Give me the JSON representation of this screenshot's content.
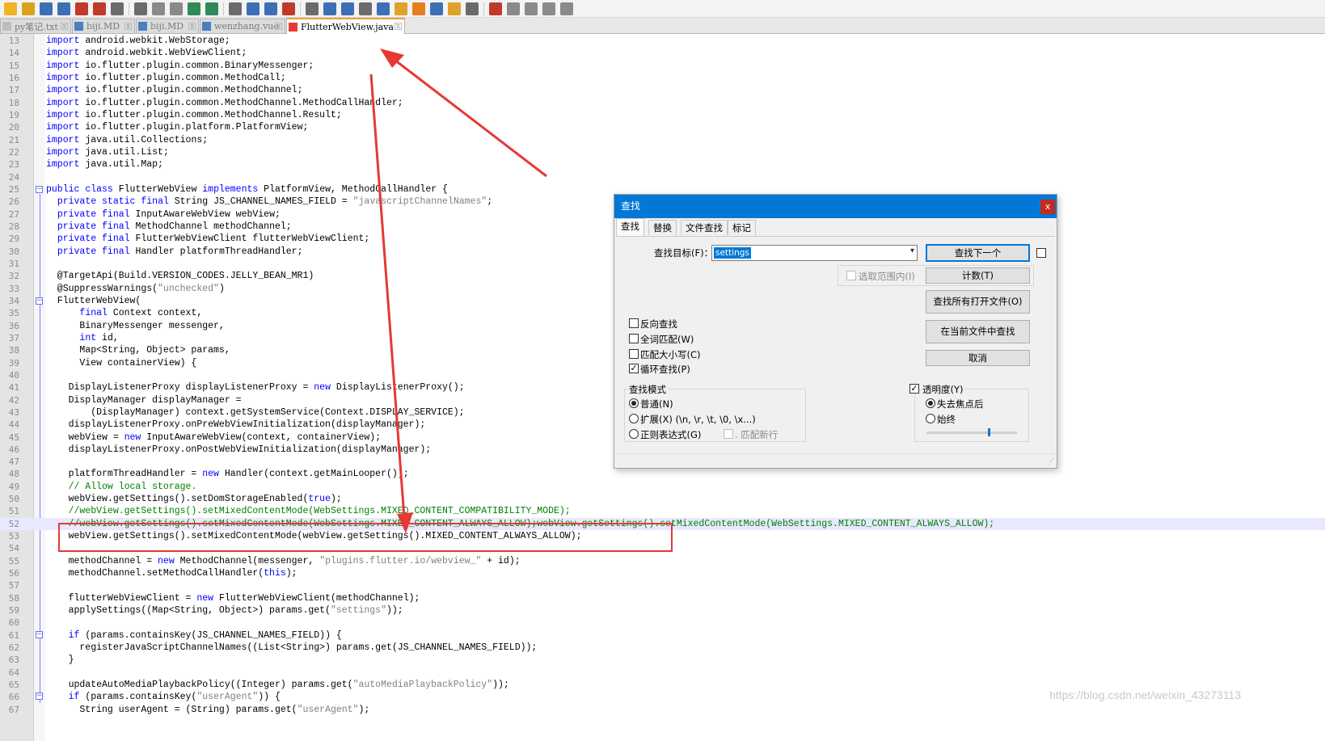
{
  "toolbar": {
    "icons": [
      "new-icon",
      "open-icon",
      "save-icon",
      "save-all-icon",
      "close-icon",
      "close-all-icon",
      "print-icon",
      "cut-icon",
      "copy-icon",
      "paste-icon",
      "undo-icon",
      "redo-icon",
      "find-icon",
      "replace-icon",
      "zoom-in-icon",
      "zoom-out-icon",
      "sync-v-icon",
      "sync-h-icon",
      "wrap-icon",
      "show-all-icon",
      "indent-guide-icon",
      "lang-icon",
      "map-icon",
      "func-list-icon",
      "folder-icon",
      "monitor-icon",
      "record-icon",
      "stop-icon",
      "play-icon",
      "play-multi-icon",
      "save-macro-icon"
    ]
  },
  "tabs": [
    {
      "label": "py笔记.txt",
      "active": false,
      "color": "#9e9e9e"
    },
    {
      "label": "biji.MD",
      "active": false,
      "color": "#4a7fc1"
    },
    {
      "label": "biji.MD",
      "active": false,
      "color": "#4a7fc1"
    },
    {
      "label": "wenzhang.vue",
      "active": false,
      "color": "#4a7fc1"
    },
    {
      "label": "FlutterWebView.java",
      "active": true,
      "color": "#e53935"
    }
  ],
  "code_lines": [
    {
      "n": "13",
      "code": "import android.webkit.WebStorage;"
    },
    {
      "n": "14",
      "code": "import android.webkit.WebViewClient;"
    },
    {
      "n": "15",
      "code": "import io.flutter.plugin.common.BinaryMessenger;"
    },
    {
      "n": "16",
      "code": "import io.flutter.plugin.common.MethodCall;"
    },
    {
      "n": "17",
      "code": "import io.flutter.plugin.common.MethodChannel;"
    },
    {
      "n": "18",
      "code": "import io.flutter.plugin.common.MethodChannel.MethodCallHandler;"
    },
    {
      "n": "19",
      "code": "import io.flutter.plugin.common.MethodChannel.Result;"
    },
    {
      "n": "20",
      "code": "import io.flutter.plugin.platform.PlatformView;"
    },
    {
      "n": "21",
      "code": "import java.util.Collections;"
    },
    {
      "n": "22",
      "code": "import java.util.List;"
    },
    {
      "n": "23",
      "code": "import java.util.Map;"
    },
    {
      "n": "24",
      "code": ""
    },
    {
      "n": "25",
      "code": "public class FlutterWebView implements PlatformView, MethodCallHandler {"
    },
    {
      "n": "26",
      "code": "  private static final String JS_CHANNEL_NAMES_FIELD = \"javascriptChannelNames\";"
    },
    {
      "n": "27",
      "code": "  private final InputAwareWebView webView;"
    },
    {
      "n": "28",
      "code": "  private final MethodChannel methodChannel;"
    },
    {
      "n": "29",
      "code": "  private final FlutterWebViewClient flutterWebViewClient;"
    },
    {
      "n": "30",
      "code": "  private final Handler platformThreadHandler;"
    },
    {
      "n": "31",
      "code": ""
    },
    {
      "n": "32",
      "code": "  @TargetApi(Build.VERSION_CODES.JELLY_BEAN_MR1)"
    },
    {
      "n": "33",
      "code": "  @SuppressWarnings(\"unchecked\")"
    },
    {
      "n": "34",
      "code": "  FlutterWebView("
    },
    {
      "n": "35",
      "code": "      final Context context,"
    },
    {
      "n": "36",
      "code": "      BinaryMessenger messenger,"
    },
    {
      "n": "37",
      "code": "      int id,"
    },
    {
      "n": "38",
      "code": "      Map<String, Object> params,"
    },
    {
      "n": "39",
      "code": "      View containerView) {"
    },
    {
      "n": "40",
      "code": ""
    },
    {
      "n": "41",
      "code": "    DisplayListenerProxy displayListenerProxy = new DisplayListenerProxy();"
    },
    {
      "n": "42",
      "code": "    DisplayManager displayManager ="
    },
    {
      "n": "43",
      "code": "        (DisplayManager) context.getSystemService(Context.DISPLAY_SERVICE);"
    },
    {
      "n": "44",
      "code": "    displayListenerProxy.onPreWebViewInitialization(displayManager);"
    },
    {
      "n": "45",
      "code": "    webView = new InputAwareWebView(context, containerView);"
    },
    {
      "n": "46",
      "code": "    displayListenerProxy.onPostWebViewInitialization(displayManager);"
    },
    {
      "n": "47",
      "code": ""
    },
    {
      "n": "48",
      "code": "    platformThreadHandler = new Handler(context.getMainLooper());"
    },
    {
      "n": "49",
      "code": "    // Allow local storage."
    },
    {
      "n": "50",
      "code": "    webView.getSettings().setDomStorageEnabled(true);"
    },
    {
      "n": "51",
      "code": "    //webView.getSettings().setMixedContentMode(WebSettings.MIXED_CONTENT_COMPATIBILITY_MODE);"
    },
    {
      "n": "52",
      "code": "    //webView.getSettings().setMixedContentMode(WebSettings.MIXED_CONTENT_ALWAYS_ALLOW);webView.getSettings().setMixedContentMode(WebSettings.MIXED_CONTENT_ALWAYS_ALLOW);"
    },
    {
      "n": "53",
      "code": "    webView.getSettings().setMixedContentMode(webView.getSettings().MIXED_CONTENT_ALWAYS_ALLOW);"
    },
    {
      "n": "54",
      "code": ""
    },
    {
      "n": "55",
      "code": "    methodChannel = new MethodChannel(messenger, \"plugins.flutter.io/webview_\" + id);"
    },
    {
      "n": "56",
      "code": "    methodChannel.setMethodCallHandler(this);"
    },
    {
      "n": "57",
      "code": ""
    },
    {
      "n": "58",
      "code": "    flutterWebViewClient = new FlutterWebViewClient(methodChannel);"
    },
    {
      "n": "59",
      "code": "    applySettings((Map<String, Object>) params.get(\"settings\"));"
    },
    {
      "n": "60",
      "code": ""
    },
    {
      "n": "61",
      "code": "    if (params.containsKey(JS_CHANNEL_NAMES_FIELD)) {"
    },
    {
      "n": "62",
      "code": "      registerJavaScriptChannelNames((List<String>) params.get(JS_CHANNEL_NAMES_FIELD));"
    },
    {
      "n": "63",
      "code": "    }"
    },
    {
      "n": "64",
      "code": ""
    },
    {
      "n": "65",
      "code": "    updateAutoMediaPlaybackPolicy((Integer) params.get(\"autoMediaPlaybackPolicy\"));"
    },
    {
      "n": "66",
      "code": "    if (params.containsKey(\"userAgent\")) {"
    },
    {
      "n": "67",
      "code": "      String userAgent = (String) params.get(\"userAgent\");"
    }
  ],
  "find_dialog": {
    "title": "查找",
    "close_label": "x",
    "tabs": [
      "查找",
      "替换",
      "文件查找",
      "标记"
    ],
    "find_target_label": "查找目标(F)：",
    "find_value": "settings",
    "buttons": {
      "find_next": "查找下一个",
      "count": "计数(T)",
      "find_all_open": "查找所有打开文件(O)",
      "find_in_current": "在当前文件中查找",
      "cancel": "取消"
    },
    "in_selection_label": "选取范围内(I)",
    "options": [
      {
        "label": "反向查找",
        "checked": false
      },
      {
        "label": "全词匹配(W)",
        "checked": false
      },
      {
        "label": "匹配大小写(C)",
        "checked": false
      },
      {
        "label": "循环查找(P)",
        "checked": true
      }
    ],
    "search_mode": {
      "title": "查找模式",
      "modes": [
        {
          "label": "普通(N)",
          "selected": true
        },
        {
          "label": "扩展(X) (\\n, \\r, \\t, \\0, \\x...)",
          "selected": false
        },
        {
          "label": "正则表达式(G)",
          "selected": false
        }
      ],
      "dot_newline_label": ". 匹配新行"
    },
    "transparency": {
      "label": "透明度(Y)",
      "checked": true,
      "modes": [
        {
          "label": "失去焦点后",
          "selected": true
        },
        {
          "label": "始终",
          "selected": false
        }
      ],
      "level": 0.7
    }
  },
  "annotations": {
    "box_color": "#e53935",
    "arrow_color": "#e53935"
  },
  "watermark": "https://blog.csdn.net/weixin_43273113"
}
